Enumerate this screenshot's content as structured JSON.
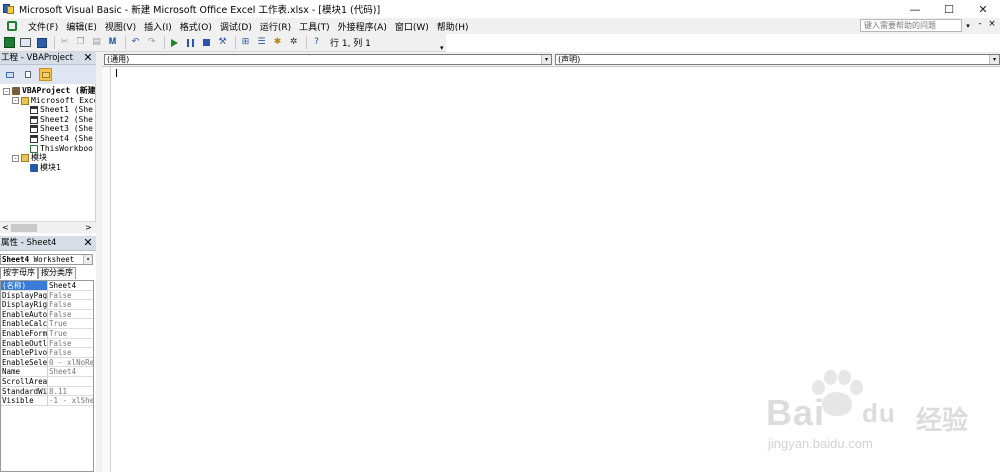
{
  "window": {
    "title": "Microsoft Visual Basic - 新建 Microsoft Office Excel 工作表.xlsx - [模块1 (代码)]",
    "controls": {
      "minimize": "—",
      "maximize": "☐",
      "close": "✕"
    }
  },
  "menu": {
    "items": [
      "文件(F)",
      "编辑(E)",
      "视图(V)",
      "插入(I)",
      "格式(O)",
      "调试(D)",
      "运行(R)",
      "工具(T)",
      "外接程序(A)",
      "窗口(W)",
      "帮助(H)"
    ],
    "help_placeholder": "键入需要帮助的问题",
    "mdi_minimize": "-",
    "mdi_close": "×"
  },
  "toolbar": {
    "position_label": "行 1, 列 1",
    "undo_glyph": "↶",
    "redo_glyph": "↷",
    "find_glyph": "𝐌",
    "help_glyph": "?",
    "cut_glyph": "✂"
  },
  "project_pane": {
    "title": "工程 - VBAProject",
    "close_glyph": "✕",
    "tree": [
      {
        "label": "VBAProject (新建",
        "level": 0,
        "icon": "project-icon",
        "expander": "-"
      },
      {
        "label": "Microsoft Exce",
        "level": 1,
        "icon": "folder-icon",
        "expander": "-"
      },
      {
        "label": "Sheet1 (She",
        "level": 2,
        "icon": "sheet-icon",
        "expander": ""
      },
      {
        "label": "Sheet2 (She",
        "level": 2,
        "icon": "sheet-icon",
        "expander": ""
      },
      {
        "label": "Sheet3 (She",
        "level": 2,
        "icon": "sheet-icon",
        "expander": ""
      },
      {
        "label": "Sheet4 (She",
        "level": 2,
        "icon": "sheet-icon",
        "expander": ""
      },
      {
        "label": "ThisWorkboo",
        "level": 2,
        "icon": "workbook-icon",
        "expander": ""
      },
      {
        "label": "模块",
        "level": 1,
        "icon": "folder-icon",
        "expander": "-"
      },
      {
        "label": "模块1",
        "level": 2,
        "icon": "module-icon",
        "expander": ""
      }
    ],
    "scroll_left": "<",
    "scroll_right": ">"
  },
  "properties_pane": {
    "title": "属性 - Sheet4",
    "close_glyph": "✕",
    "object_name": "Sheet4",
    "object_type": "Worksheet",
    "dropdown_glyph": "▾",
    "tabs": [
      "按字母序",
      "按分类序"
    ],
    "rows": [
      {
        "name": "(名称)",
        "value": "Sheet4"
      },
      {
        "name": "DisplayPage",
        "value": "False"
      },
      {
        "name": "DisplayRigh",
        "value": "False"
      },
      {
        "name": "EnableAutoF",
        "value": "False"
      },
      {
        "name": "EnableCalcu",
        "value": "True"
      },
      {
        "name": "EnableForma",
        "value": "True"
      },
      {
        "name": "EnableOutli",
        "value": "False"
      },
      {
        "name": "EnablePivot",
        "value": "False"
      },
      {
        "name": "EnableSelec",
        "value": "0 - xlNoRe"
      },
      {
        "name": "Name",
        "value": "Sheet4"
      },
      {
        "name": "ScrollArea",
        "value": ""
      },
      {
        "name": "StandardWid",
        "value": "8.11"
      },
      {
        "name": "Visible",
        "value": "-1 - xlShe"
      }
    ]
  },
  "code_window": {
    "object_combo": "(通用)",
    "proc_combo": "(声明)",
    "dropdown_glyph": "▾"
  },
  "watermark": {
    "brand": "Bai",
    "brand_du": "du",
    "brand_cn": "经验",
    "url": "jingyan.baidu.com"
  }
}
